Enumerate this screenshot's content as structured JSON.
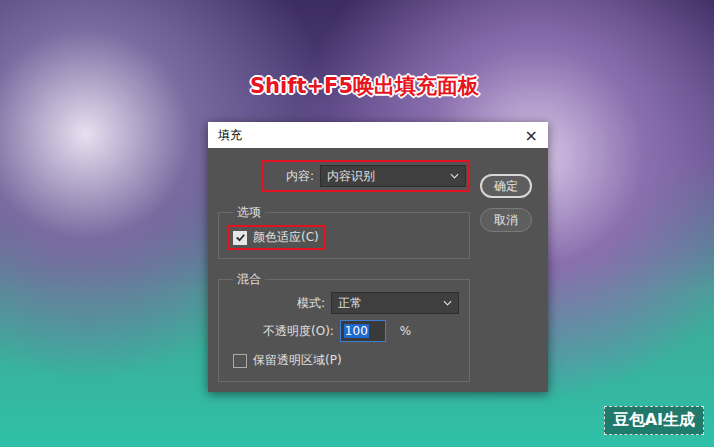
{
  "annotation": {
    "text": "Shift+F5唤出填充面板"
  },
  "watermark": {
    "text": "豆包AI生成"
  },
  "dialog": {
    "title": "填充",
    "close": "×",
    "content": {
      "label": "内容:",
      "value": "内容识别",
      "highlighted": true
    },
    "buttons": [
      {
        "label": "确定",
        "default": true
      },
      {
        "label": "取消",
        "default": false
      }
    ],
    "options": {
      "title": "选项",
      "checkboxes": [
        {
          "label": "颜色适应(C)",
          "checked": true,
          "highlighted": true
        }
      ]
    },
    "blend": {
      "title": "混合",
      "mode": {
        "label": "模式:",
        "value": "正常"
      },
      "opacity": {
        "label": "不透明度(O):",
        "value": "100",
        "unit": "%",
        "selected": true
      },
      "checkboxes": [
        {
          "label": "保留透明区域(P)",
          "checked": false,
          "highlighted": false
        }
      ]
    }
  }
}
